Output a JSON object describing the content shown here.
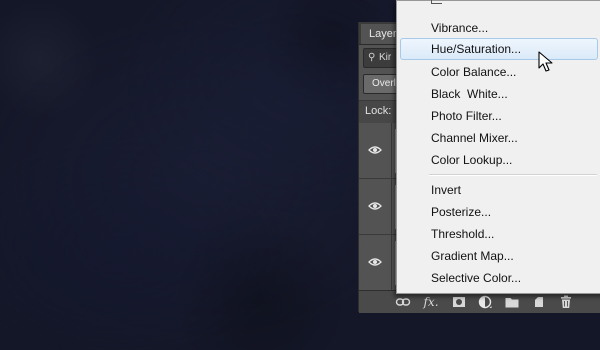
{
  "layers_panel": {
    "tab_label": "Layers",
    "filter_text": "Kir",
    "blend_mode": "Overla",
    "lock_label": "Lock:",
    "layers": [
      {
        "visible": true
      },
      {
        "visible": true
      },
      {
        "visible": true
      }
    ],
    "footer_icons": [
      "link-icon",
      "fx-icon",
      "mask-icon",
      "adjustment-icon",
      "folder-icon",
      "new-layer-icon",
      "trash-icon"
    ],
    "fx_label": "fx."
  },
  "adjustment_menu": {
    "items": [
      {
        "label": "Vibrance..."
      },
      {
        "label": "Hue/Saturation...",
        "highlighted": true
      },
      {
        "label": "Color Balance..."
      },
      {
        "label": "Black  White..."
      },
      {
        "label": "Photo Filter..."
      },
      {
        "label": "Channel Mixer..."
      },
      {
        "label": "Color Lookup..."
      },
      {
        "label": "Invert"
      },
      {
        "label": "Posterize..."
      },
      {
        "label": "Threshold..."
      },
      {
        "label": "Gradient Map..."
      },
      {
        "label": "Selective Color..."
      }
    ]
  },
  "colors": {
    "canvas_bg": "#141728",
    "panel_bg": "#535353",
    "menu_bg": "#f0f0f0",
    "menu_highlight": "#dbeaf9"
  }
}
